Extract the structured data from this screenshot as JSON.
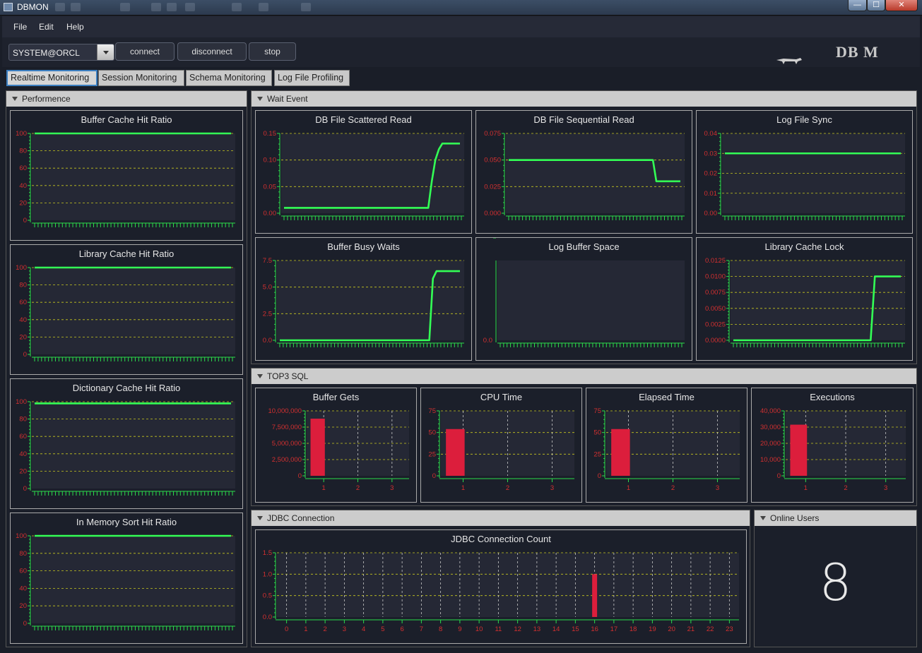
{
  "window": {
    "title": "DBMON",
    "min": "—",
    "max": "☐",
    "close": "✕"
  },
  "menu": [
    "File",
    "Edit",
    "Help"
  ],
  "toolbar": {
    "connection": "SYSTEM@ORCL",
    "connect": "connect",
    "disconnect": "disconnect",
    "stop": "stop",
    "logo": "DB M"
  },
  "tabs": [
    "Realtime Monitoring",
    "Session Monitoring",
    "Schema Monitoring",
    "Log File Profiling"
  ],
  "panels": {
    "performance": "Performence",
    "wait_event": "Wait Event",
    "top3": "TOP3 SQL",
    "jdbc": "JDBC Connection",
    "online": "Online Users"
  },
  "online_users": "8",
  "colors": {
    "line": "#33ff55",
    "bar": "#dc1e3c",
    "grid": "#c8c81e",
    "plot_bg": "#252835",
    "axis": "#2bdc4b",
    "tick_label": "#d23030"
  },
  "chart_data": [
    {
      "id": "buffer_cache",
      "title": "Buffer Cache Hit Ratio",
      "type": "line",
      "ylim": [
        0,
        100
      ],
      "yticks": [
        "0",
        "20",
        "40",
        "60",
        "80",
        "100"
      ],
      "series": [
        {
          "values": [
            100,
            100
          ]
        }
      ]
    },
    {
      "id": "library_cache",
      "title": "Library Cache Hit Ratio",
      "type": "line",
      "ylim": [
        0,
        100
      ],
      "yticks": [
        "0",
        "20",
        "40",
        "60",
        "80",
        "100"
      ],
      "series": [
        {
          "values": [
            100,
            100
          ]
        }
      ]
    },
    {
      "id": "dict_cache",
      "title": "Dictionary Cache Hit Ratio",
      "type": "line",
      "ylim": [
        0,
        100
      ],
      "yticks": [
        "0",
        "20",
        "40",
        "60",
        "80",
        "100"
      ],
      "series": [
        {
          "values": [
            98,
            98
          ]
        }
      ]
    },
    {
      "id": "mem_sort",
      "title": "In Memory Sort Hit Ratio",
      "type": "line",
      "ylim": [
        0,
        100
      ],
      "yticks": [
        "0",
        "20",
        "40",
        "60",
        "80",
        "100"
      ],
      "series": [
        {
          "values": [
            100,
            100
          ]
        }
      ]
    },
    {
      "id": "db_scattered",
      "title": "DB File Scattered Read",
      "type": "line",
      "ylim": [
        0,
        0.15
      ],
      "yticks": [
        "0.00",
        "0.05",
        "0.10",
        "0.15"
      ],
      "series": [
        {
          "x": [
            0,
            0.82,
            0.84,
            0.86,
            0.88,
            0.9,
            1
          ],
          "values": [
            0.01,
            0.01,
            0.06,
            0.1,
            0.12,
            0.131,
            0.131
          ]
        }
      ]
    },
    {
      "id": "db_sequential",
      "title": "DB File Sequential Read",
      "type": "line",
      "ylim": [
        0,
        0.075
      ],
      "yticks": [
        "0.000",
        "0.025",
        "0.050",
        "0.075"
      ],
      "series": [
        {
          "x": [
            0,
            0.84,
            0.86,
            1
          ],
          "values": [
            0.05,
            0.05,
            0.03,
            0.03
          ]
        }
      ]
    },
    {
      "id": "log_file_sync",
      "title": "Log File Sync",
      "type": "line",
      "ylim": [
        0,
        0.04
      ],
      "yticks": [
        "0.00",
        "0.01",
        "0.02",
        "0.03",
        "0.04"
      ],
      "series": [
        {
          "values": [
            0.03,
            0.03
          ]
        }
      ]
    },
    {
      "id": "buffer_busy",
      "title": "Buffer Busy Waits",
      "type": "line",
      "ylim": [
        0,
        7.5
      ],
      "yticks": [
        "0.0",
        "2.5",
        "5.0",
        "7.5"
      ],
      "series": [
        {
          "x": [
            0,
            0.83,
            0.85,
            0.87,
            0.88,
            1
          ],
          "values": [
            0,
            0,
            5.8,
            6.5,
            6.5,
            6.5
          ]
        }
      ]
    },
    {
      "id": "log_buffer_space",
      "title": "Log Buffer Space",
      "type": "line",
      "ylim": [
        0,
        1
      ],
      "yticks": [
        "0.0"
      ],
      "nogrid": true,
      "series": []
    },
    {
      "id": "library_cache_lock",
      "title": "Library Cache Lock",
      "type": "line",
      "ylim": [
        0,
        0.0125
      ],
      "yticks": [
        "0.0000",
        "0.0025",
        "0.0050",
        "0.0075",
        "0.0100",
        "0.0125"
      ],
      "series": [
        {
          "x": [
            0,
            0.82,
            0.845,
            1
          ],
          "values": [
            0,
            0,
            0.01,
            0.01
          ]
        }
      ]
    },
    {
      "id": "buffer_gets",
      "title": "Buffer Gets",
      "type": "bar",
      "ylim": [
        0,
        10000000
      ],
      "yticks": [
        "0",
        "2,500,000",
        "5,000,000",
        "7,500,000",
        "10,000,000"
      ],
      "categories": [
        "1",
        "2",
        "3"
      ],
      "values": [
        8800000,
        null,
        null
      ]
    },
    {
      "id": "cpu_time",
      "title": "CPU Time",
      "type": "bar",
      "ylim": [
        0,
        75
      ],
      "yticks": [
        "0",
        "25",
        "50",
        "75"
      ],
      "categories": [
        "1",
        "2",
        "3"
      ],
      "values": [
        54,
        null,
        null
      ]
    },
    {
      "id": "elapsed_time",
      "title": "Elapsed Time",
      "type": "bar",
      "ylim": [
        0,
        75
      ],
      "yticks": [
        "0",
        "25",
        "50",
        "75"
      ],
      "categories": [
        "1",
        "2",
        "3"
      ],
      "values": [
        54,
        null,
        null
      ]
    },
    {
      "id": "executions",
      "title": "Executions",
      "type": "bar",
      "ylim": [
        0,
        40000
      ],
      "yticks": [
        "0",
        "10,000",
        "20,000",
        "30,000",
        "40,000"
      ],
      "categories": [
        "1",
        "2",
        "3"
      ],
      "values": [
        31500,
        null,
        null
      ]
    },
    {
      "id": "jdbc_count",
      "title": "JDBC Connection Count",
      "type": "bar",
      "ylim": [
        0,
        1.5
      ],
      "yticks": [
        "0.0",
        "0.5",
        "1.0",
        "1.5"
      ],
      "categories": [
        "0",
        "1",
        "2",
        "3",
        "4",
        "5",
        "6",
        "7",
        "8",
        "9",
        "10",
        "11",
        "12",
        "13",
        "14",
        "15",
        "16",
        "17",
        "18",
        "19",
        "20",
        "21",
        "22",
        "23"
      ],
      "values": [
        null,
        null,
        null,
        null,
        null,
        null,
        null,
        null,
        null,
        null,
        null,
        null,
        null,
        null,
        null,
        null,
        1,
        null,
        null,
        null,
        null,
        null,
        null,
        null
      ]
    }
  ]
}
